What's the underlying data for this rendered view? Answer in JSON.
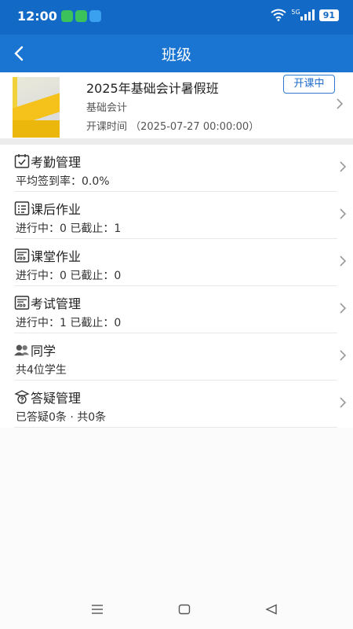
{
  "status_bar": {
    "time": "12:00",
    "battery": "91",
    "network": "5G"
  },
  "header": {
    "title": "班级"
  },
  "course": {
    "title": "2025年基础会计暑假班",
    "subject": "基础会计",
    "start_time": "开课时间 （2025-07-27 00:00:00）",
    "status_badge": "开课中"
  },
  "menu": [
    {
      "icon": "attendance-icon",
      "label": "考勤管理",
      "sub": "平均签到率：0.0%"
    },
    {
      "icon": "homework-icon",
      "label": "课后作业",
      "sub": "进行中：0  已截止：1"
    },
    {
      "icon": "classwork-icon",
      "label": "课堂作业",
      "sub": "进行中：0  已截止：0"
    },
    {
      "icon": "exam-icon",
      "label": "考试管理",
      "sub": "进行中：1  已截止：0"
    },
    {
      "icon": "students-icon",
      "label": "同学",
      "sub": "共4位学生"
    },
    {
      "icon": "qa-icon",
      "label": "答疑管理",
      "sub": "已答疑0条 · 共0条"
    }
  ],
  "colors": {
    "header": "#1974d2",
    "accent": "#1e6cc8"
  }
}
